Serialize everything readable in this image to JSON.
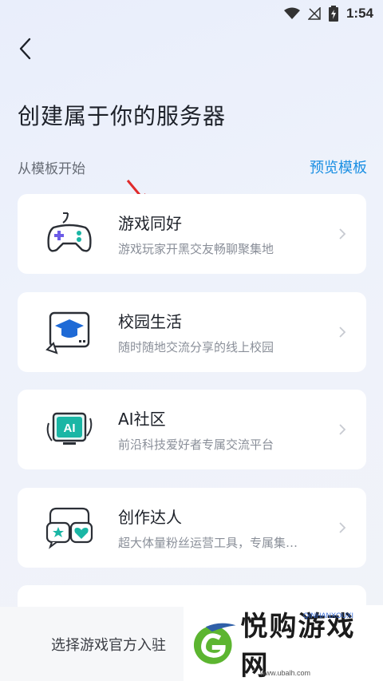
{
  "status": {
    "time": "1:54"
  },
  "header": {
    "title": "创建属于你的服务器"
  },
  "section": {
    "label": "从模板开始",
    "preview_label": "预览模板"
  },
  "templates": [
    {
      "title": "游戏同好",
      "subtitle": "游戏玩家开黑交友畅聊聚集地",
      "icon": "gamepad-icon"
    },
    {
      "title": "校园生活",
      "subtitle": "随时随地交流分享的线上校园",
      "icon": "graduation-cap-icon"
    },
    {
      "title": "AI社区",
      "subtitle": "前沿科技爱好者专属交流平台",
      "icon": "ai-icon"
    },
    {
      "title": "创作达人",
      "subtitle": "超大体量粉丝运营工具，专属集…",
      "icon": "chat-bubbles-icon"
    }
  ],
  "bottom": {
    "text": "选择游戏官方入驻"
  },
  "watermark": {
    "text": "悦购游戏网",
    "url": "www.ubalh.com",
    "tag": "QINHANXOUXI"
  },
  "colors": {
    "accent": "#1a8fe3",
    "icon_purple": "#6c5ce7",
    "icon_teal": "#1ab6a5"
  }
}
